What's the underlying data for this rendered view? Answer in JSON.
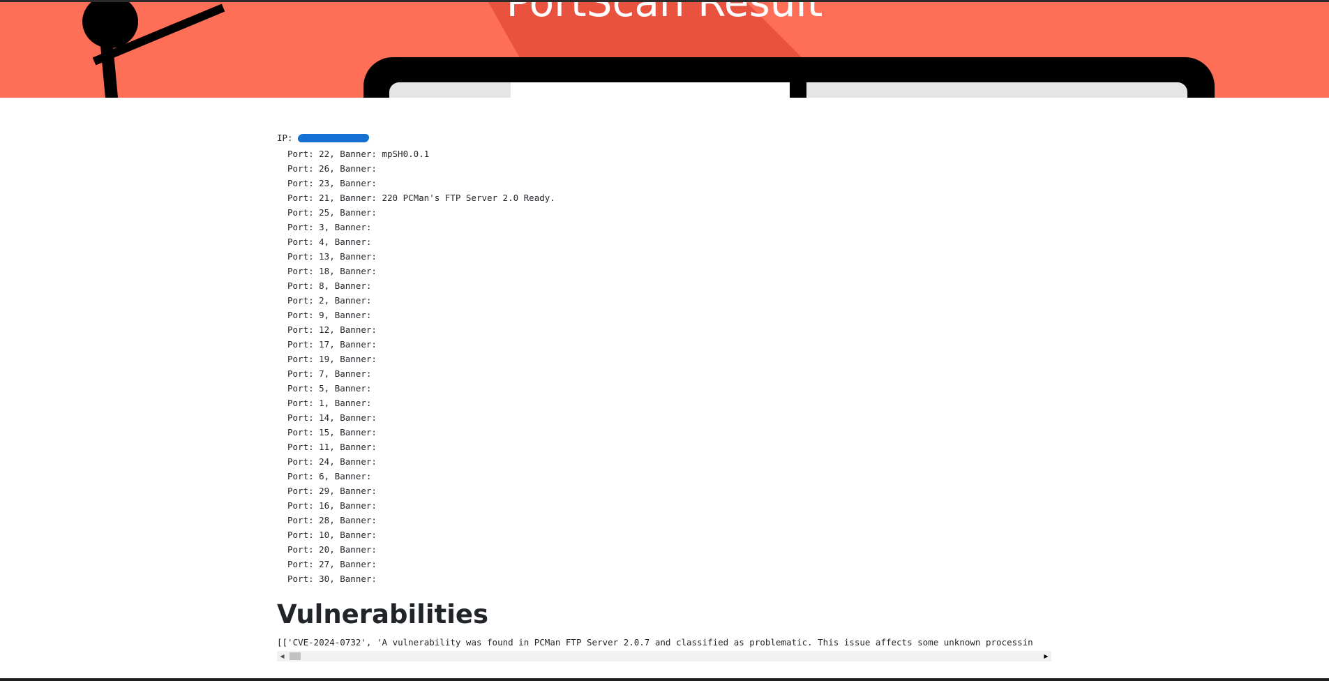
{
  "hero": {
    "title": "PortScan Result"
  },
  "scan": {
    "ip_label": "IP:",
    "ports": [
      "Port: 22, Banner: mpSH0.0.1",
      "Port: 26, Banner:",
      "Port: 23, Banner:",
      "Port: 21, Banner: 220 PCMan's FTP Server 2.0 Ready.",
      "Port: 25, Banner:",
      "Port: 3, Banner:",
      "Port: 4, Banner:",
      "Port: 13, Banner:",
      "Port: 18, Banner:",
      "Port: 8, Banner:",
      "Port: 2, Banner:",
      "Port: 9, Banner:",
      "Port: 12, Banner:",
      "Port: 17, Banner:",
      "Port: 19, Banner:",
      "Port: 7, Banner:",
      "Port: 5, Banner:",
      "Port: 1, Banner:",
      "Port: 14, Banner:",
      "Port: 15, Banner:",
      "Port: 11, Banner:",
      "Port: 24, Banner:",
      "Port: 6, Banner:",
      "Port: 29, Banner:",
      "Port: 16, Banner:",
      "Port: 28, Banner:",
      "Port: 10, Banner:",
      "Port: 20, Banner:",
      "Port: 27, Banner:",
      "Port: 30, Banner:"
    ]
  },
  "vulnerabilities": {
    "heading": "Vulnerabilities",
    "text": "[['CVE-2024-0732', 'A vulnerability was found in PCMan FTP Server 2.0.7 and classified as problematic. This issue affects some unknown processin"
  },
  "colors": {
    "hero_background": "#ff6e57",
    "redaction": "#1570d4"
  },
  "icons": {
    "scroll_left": "triangle-left-icon",
    "scroll_right": "triangle-right-icon"
  }
}
